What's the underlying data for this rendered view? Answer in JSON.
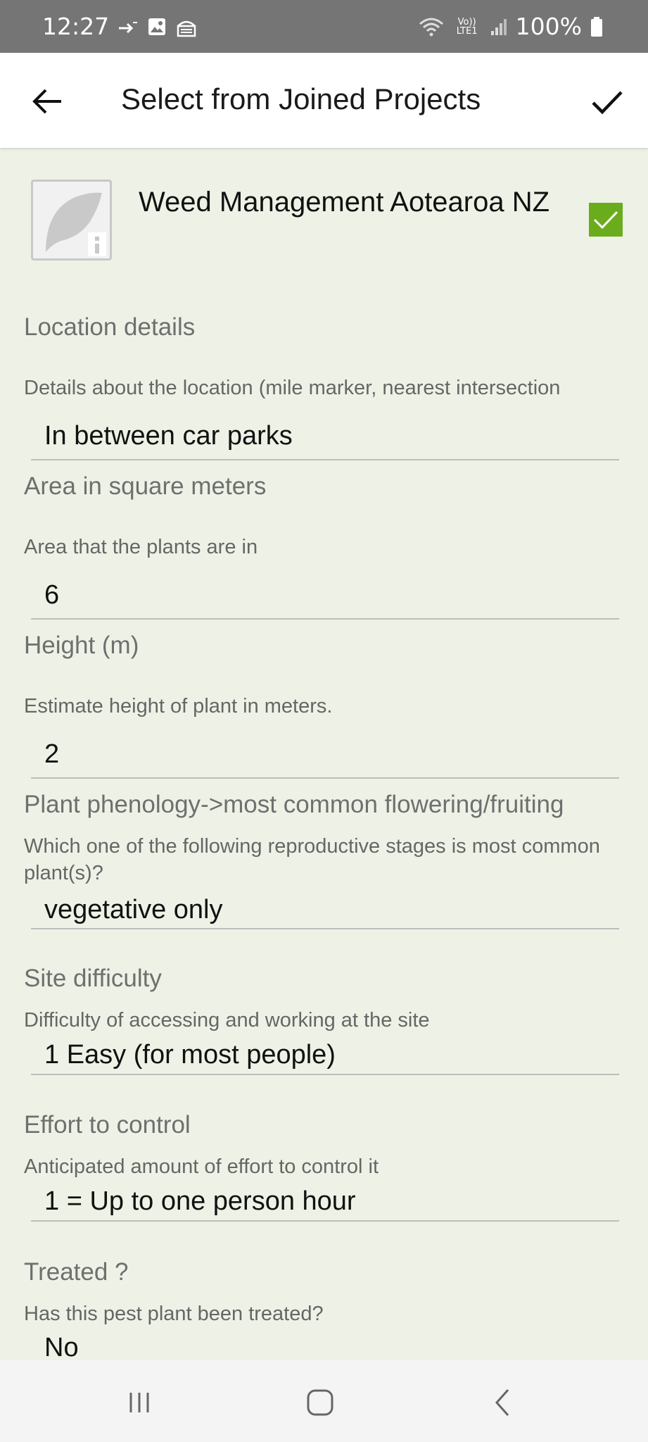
{
  "status_bar": {
    "time": "12:27",
    "battery_percent": "100%",
    "network_label": "Vo)) LTE1",
    "icons": [
      "call-forward-icon",
      "gallery-icon",
      "vpn-icon",
      "wifi-icon",
      "signal-icon",
      "battery-icon"
    ]
  },
  "app_bar": {
    "title": "Select from Joined Projects",
    "icons": [
      "arrow-back-icon",
      "check-icon"
    ]
  },
  "project": {
    "name": "Weed Management Aotearoa NZ",
    "selected": true,
    "check_color": "#6aac1b"
  },
  "fields": [
    {
      "label": "Location details",
      "description": "Details about the location (mile marker, nearest intersection",
      "value": "In between car parks"
    },
    {
      "label": "Area in square meters",
      "description": "Area that the plants are in",
      "value": "6"
    },
    {
      "label": "Height (m)",
      "description": "Estimate height of plant in meters.",
      "value": "2"
    },
    {
      "label": "Plant phenology->most common flowering/fruiting",
      "description": "Which one of the following reproductive stages is most common plant(s)?",
      "value": "vegetative only"
    },
    {
      "label": "Site difficulty",
      "description": "Difficulty of accessing and working at the site",
      "value": "1 Easy (for most people)"
    },
    {
      "label": "Effort to control",
      "description": "Anticipated amount of effort to control it",
      "value": "1 = Up to one person hour"
    },
    {
      "label": "Treated ?",
      "description": "Has this pest plant been treated?",
      "value": "No"
    }
  ],
  "nav_bar": {
    "icons": [
      "recent-apps-icon",
      "home-icon",
      "back-icon"
    ]
  },
  "colors": {
    "background": "#eef2e6",
    "status_bar": "#757575",
    "app_bar": "#ffffff",
    "accent": "#6aac1b"
  }
}
